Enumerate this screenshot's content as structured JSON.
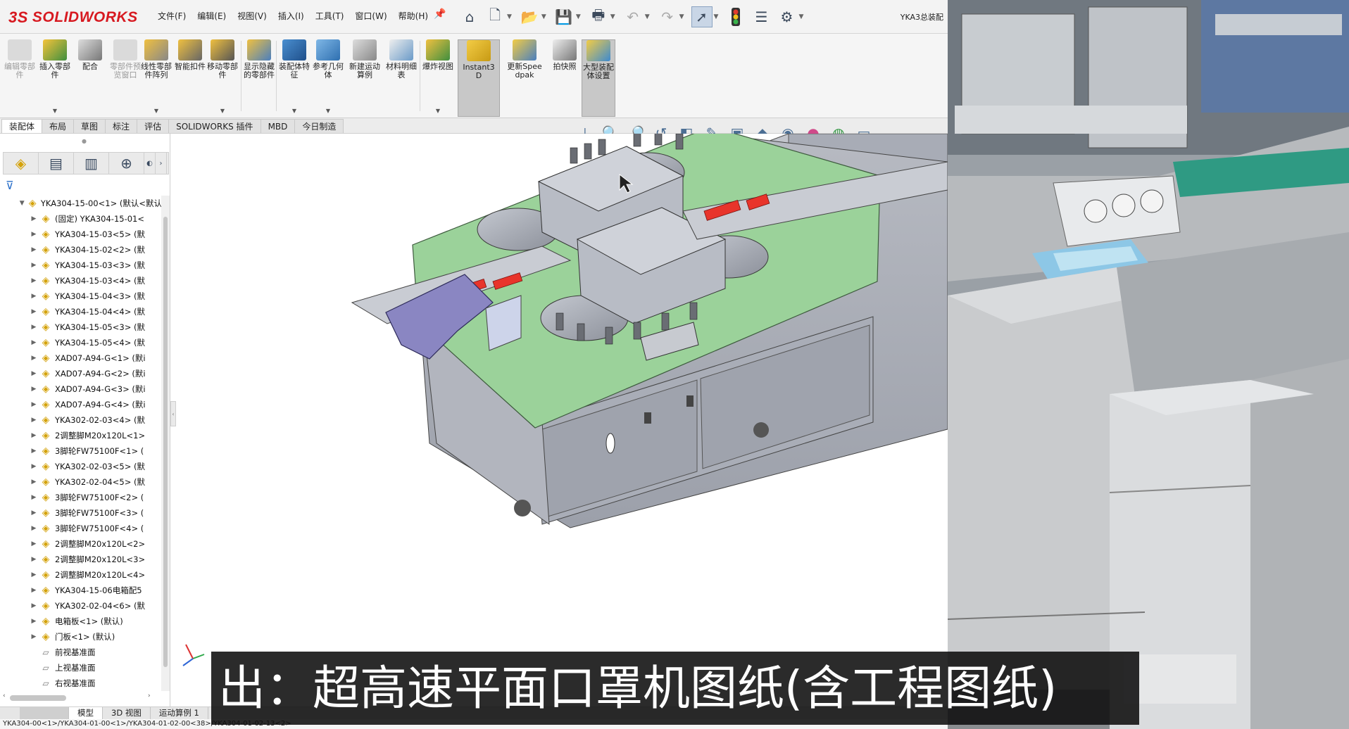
{
  "app": {
    "logo_text": "SOLIDWORKS",
    "logo_mark": "3S",
    "document_title": "YKA3总装配",
    "brand_color": "#d71920"
  },
  "menu": [
    "文件(F)",
    "编辑(E)",
    "视图(V)",
    "插入(I)",
    "工具(T)",
    "窗口(W)",
    "帮助(H)"
  ],
  "quick_access": [
    "home-icon",
    "new-icon",
    "open-icon",
    "save-icon",
    "print-icon",
    "undo-icon",
    "redo-icon",
    "select-icon",
    "rebuild-icon",
    "file-properties-icon",
    "options-icon"
  ],
  "ribbon": [
    {
      "label": "编辑零部件",
      "disabled": true
    },
    {
      "label": "插入零部件",
      "disabled": false
    },
    {
      "label": "配合",
      "disabled": false
    },
    {
      "label": "零部件预览窗口",
      "disabled": true
    },
    {
      "label": "线性零部件阵列",
      "disabled": false
    },
    {
      "label": "智能扣件",
      "disabled": false
    },
    {
      "label": "移动零部件",
      "disabled": false
    },
    {
      "label": "显示隐藏的零部件",
      "disabled": false
    },
    {
      "label": "装配体特征",
      "disabled": false
    },
    {
      "label": "参考几何体",
      "disabled": false
    },
    {
      "label": "新建运动算例",
      "disabled": false
    },
    {
      "label": "材料明细表",
      "disabled": false
    },
    {
      "label": "爆炸视图",
      "disabled": false
    },
    {
      "label": "Instant3D",
      "disabled": false,
      "selected": true
    },
    {
      "label": "更新Speedpak",
      "disabled": false
    },
    {
      "label": "拍快照",
      "disabled": false
    },
    {
      "label": "大型装配体设置",
      "disabled": false,
      "selected": true
    }
  ],
  "command_tabs": [
    "装配体",
    "布局",
    "草图",
    "标注",
    "评估",
    "SOLIDWORKS 插件",
    "MBD",
    "今日制造"
  ],
  "heads_up_icons": [
    "view-orientation-icon",
    "zoom-to-fit-icon",
    "zoom-area-icon",
    "previous-view-icon",
    "section-view-icon",
    "dynamic-annotation-icon",
    "view-orientation-cube-icon",
    "display-style-icon",
    "hide-show-icon",
    "appearance-icon",
    "scene-icon",
    "view-settings-icon"
  ],
  "feature_tree": {
    "root": "YKA304-15-00<1> (默认<默认",
    "items": [
      {
        "label": "(固定) YKA304-15-01<",
        "icon": "assembly"
      },
      {
        "label": "YKA304-15-03<5> (默",
        "icon": "assembly"
      },
      {
        "label": "YKA304-15-02<2> (默",
        "icon": "assembly"
      },
      {
        "label": "YKA304-15-03<3> (默",
        "icon": "assembly"
      },
      {
        "label": "YKA304-15-03<4> (默",
        "icon": "assembly"
      },
      {
        "label": "YKA304-15-04<3> (默",
        "icon": "assembly"
      },
      {
        "label": "YKA304-15-04<4> (默",
        "icon": "assembly"
      },
      {
        "label": "YKA304-15-05<3> (默",
        "icon": "assembly"
      },
      {
        "label": "YKA304-15-05<4> (默",
        "icon": "assembly"
      },
      {
        "label": "XAD07-A94-G<1> (默i",
        "icon": "assembly"
      },
      {
        "label": "XAD07-A94-G<2> (默i",
        "icon": "assembly"
      },
      {
        "label": "XAD07-A94-G<3> (默i",
        "icon": "assembly"
      },
      {
        "label": "XAD07-A94-G<4> (默i",
        "icon": "assembly"
      },
      {
        "label": "YKA302-02-03<4> (默",
        "icon": "assembly"
      },
      {
        "label": "2调整脚M20x120L<1>",
        "icon": "assembly"
      },
      {
        "label": "3脚轮FW75100F<1> (",
        "icon": "assembly"
      },
      {
        "label": "YKA302-02-03<5> (默",
        "icon": "assembly"
      },
      {
        "label": "YKA302-02-04<5> (默",
        "icon": "assembly"
      },
      {
        "label": "3脚轮FW75100F<2> (",
        "icon": "assembly"
      },
      {
        "label": "3脚轮FW75100F<3> (",
        "icon": "assembly"
      },
      {
        "label": "3脚轮FW75100F<4> (",
        "icon": "assembly"
      },
      {
        "label": "2调整脚M20x120L<2>",
        "icon": "assembly"
      },
      {
        "label": "2调整脚M20x120L<3>",
        "icon": "assembly"
      },
      {
        "label": "2调整脚M20x120L<4>",
        "icon": "assembly"
      },
      {
        "label": "YKA304-15-06电箱配5",
        "icon": "assembly"
      },
      {
        "label": "YKA302-02-04<6> (默",
        "icon": "assembly"
      },
      {
        "label": "电箱板<1> (默认)",
        "icon": "assembly"
      },
      {
        "label": "门板<1> (默认)",
        "icon": "assembly"
      },
      {
        "label": "前视基准面",
        "icon": "plane"
      },
      {
        "label": "上视基准面",
        "icon": "plane"
      },
      {
        "label": "右视基准面",
        "icon": "plane"
      }
    ]
  },
  "bottom_tabs": [
    "模型",
    "3D 视图",
    "运动算例 1"
  ],
  "status_path": "YKA304-00<1>/YKA304-01-00<1>/YKA304-01-02-00<38>/YKA304-01-02-13<2>",
  "subtitle": "出：超高速平面口罩机图纸(含工程图纸)",
  "colors": {
    "model_plate": "#9bd29a",
    "model_metal": "#a9adb8",
    "model_highlight": "#e8342b",
    "model_purple": "#8a86c2"
  }
}
